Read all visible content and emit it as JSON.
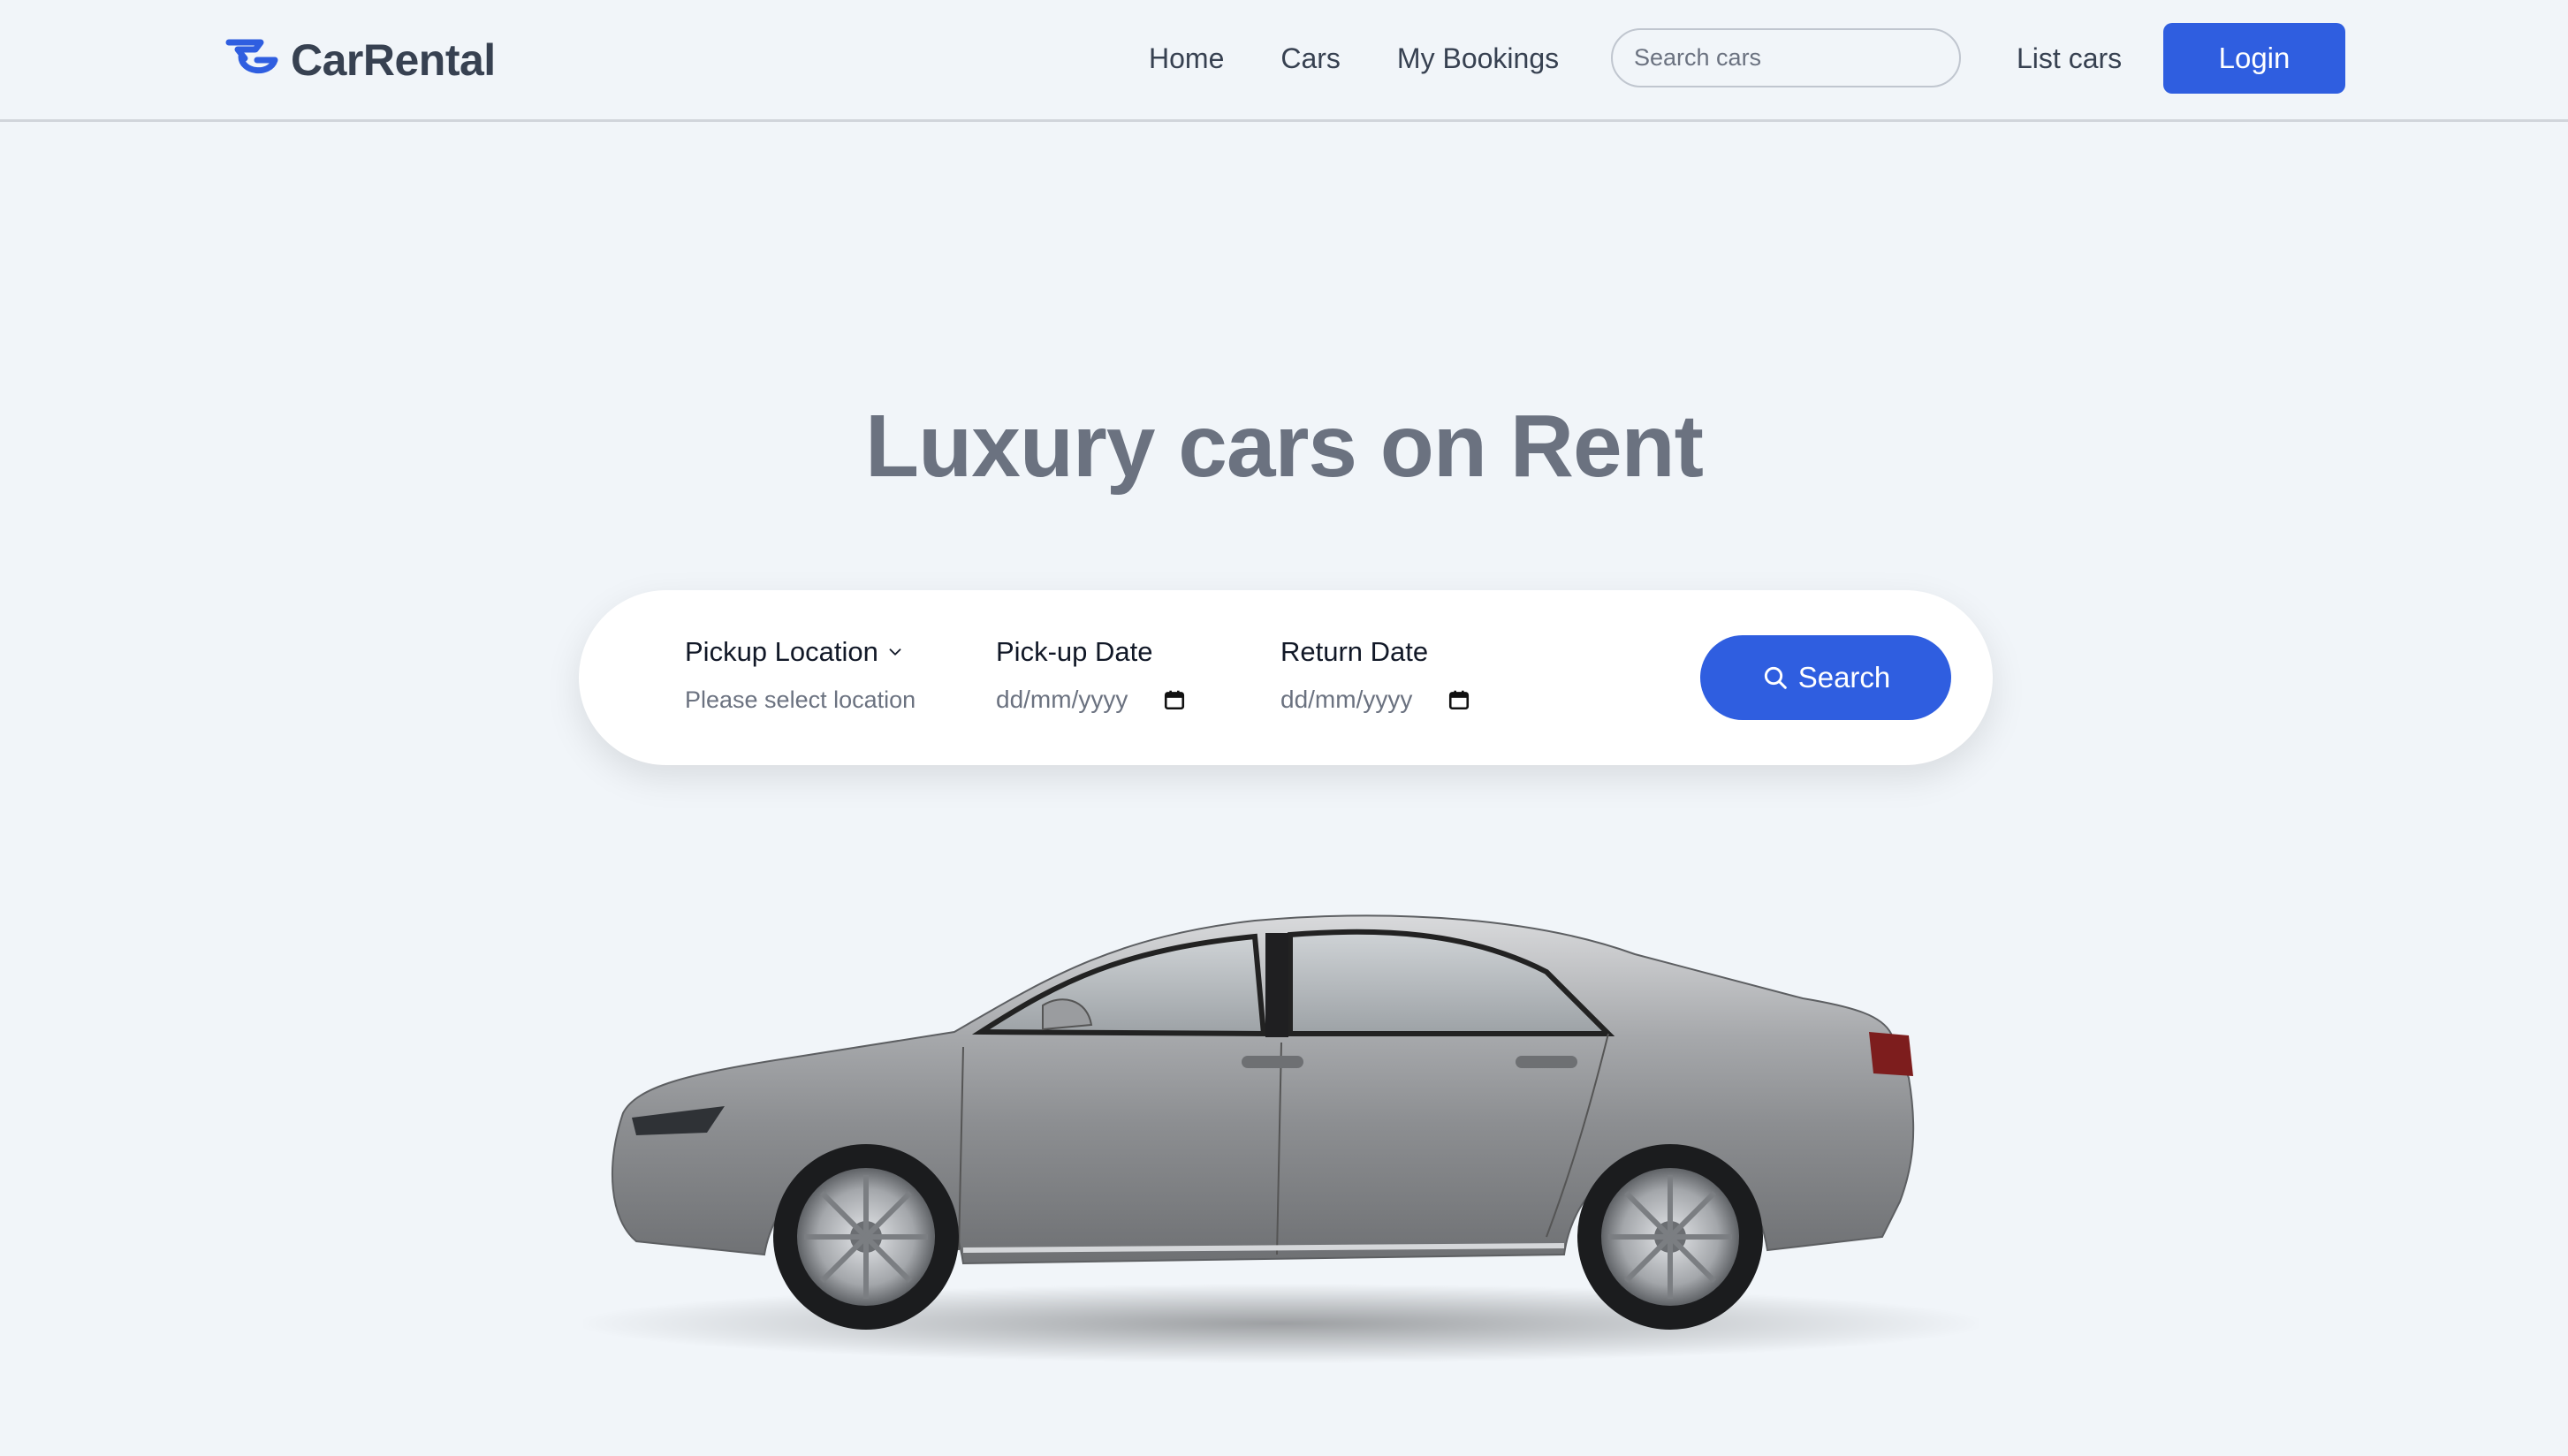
{
  "brand": {
    "name": "CarRental",
    "accent": "#2f5ee0"
  },
  "nav": {
    "links": [
      "Home",
      "Cars",
      "My Bookings"
    ],
    "search_placeholder": "Search cars",
    "list_cars": "List cars",
    "login": "Login"
  },
  "hero": {
    "title": "Luxury cars on Rent"
  },
  "booking": {
    "pickup_location_label": "Pickup Location",
    "pickup_location_value": "Please select location",
    "pickup_date_label": "Pick-up Date",
    "pickup_date_placeholder": "dd/mm/yyyy",
    "return_date_label": "Return Date",
    "return_date_placeholder": "dd/mm/yyyy",
    "search_button": "Search"
  },
  "icons": {
    "logo": "logo-mark-icon",
    "search": "search-icon",
    "chevron": "chevron-down-icon",
    "calendar": "calendar-icon"
  }
}
